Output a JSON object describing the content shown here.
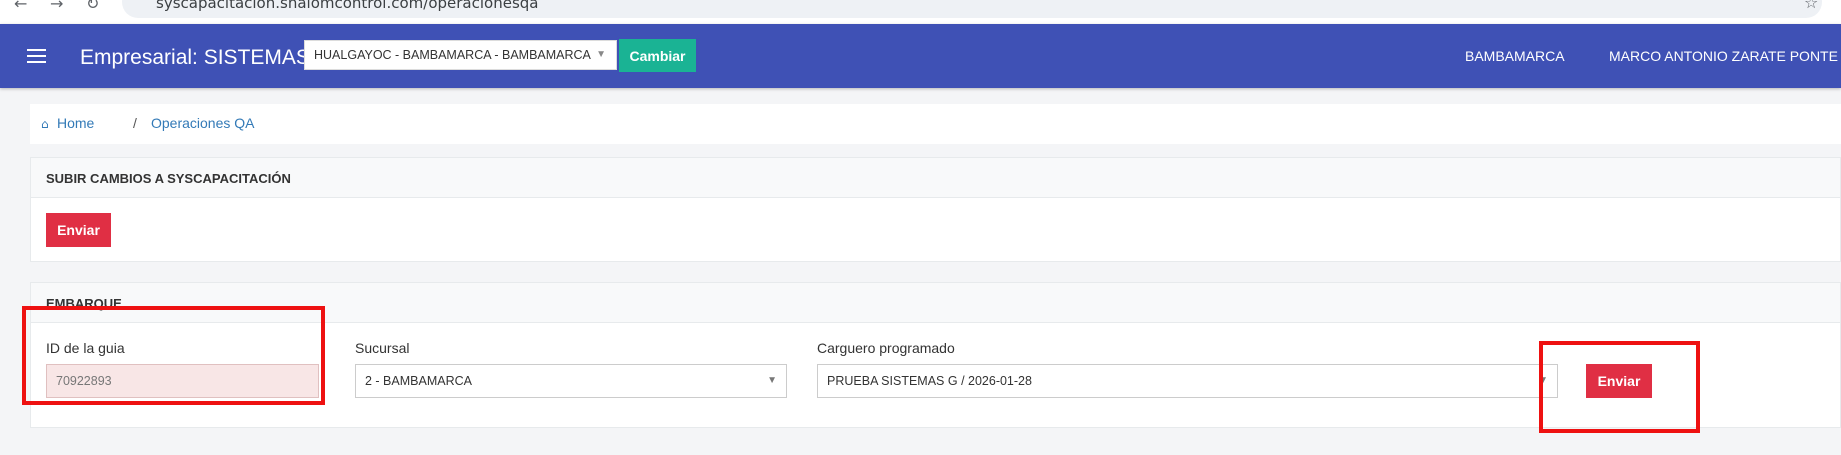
{
  "browser": {
    "url": "syscapacitacion.shalomcontrol.com/operacionesqa",
    "back_icon": "←",
    "forward_icon": "→",
    "reload_icon": "↻",
    "star_icon": "☆"
  },
  "header": {
    "title": "Empresarial: SISTEMAS",
    "branch_selector": "HUALGAYOC - BAMBAMARCA - BAMBAMARCA",
    "change_button": "Cambiar",
    "current_branch": "BAMBAMARCA",
    "user_name": "MARCO ANTONIO ZARATE PONTE"
  },
  "breadcrumb": {
    "home": "Home",
    "separator": "/",
    "current": "Operaciones QA"
  },
  "sync_panel": {
    "title": "SUBIR CAMBIOS A SYSCAPACITACIÓN",
    "send_button": "Enviar"
  },
  "embarque_panel": {
    "title": "EMBARQUE",
    "guide_id_label": "ID de la guia",
    "guide_id_value": "70922893",
    "branch_label": "Sucursal",
    "branch_value": "2 - BAMBAMARCA",
    "scheduled_cargo_label": "Carguero programado",
    "scheduled_cargo_value": "PRUEBA SISTEMAS G / 2026-01-28",
    "send_button": "Enviar"
  },
  "colors": {
    "nav_bg": "#3f51b5",
    "cambiar_btn": "#1ab394",
    "enviar_btn": "#e02f44",
    "link": "#337ab7",
    "highlight_box": "#ee1111"
  }
}
